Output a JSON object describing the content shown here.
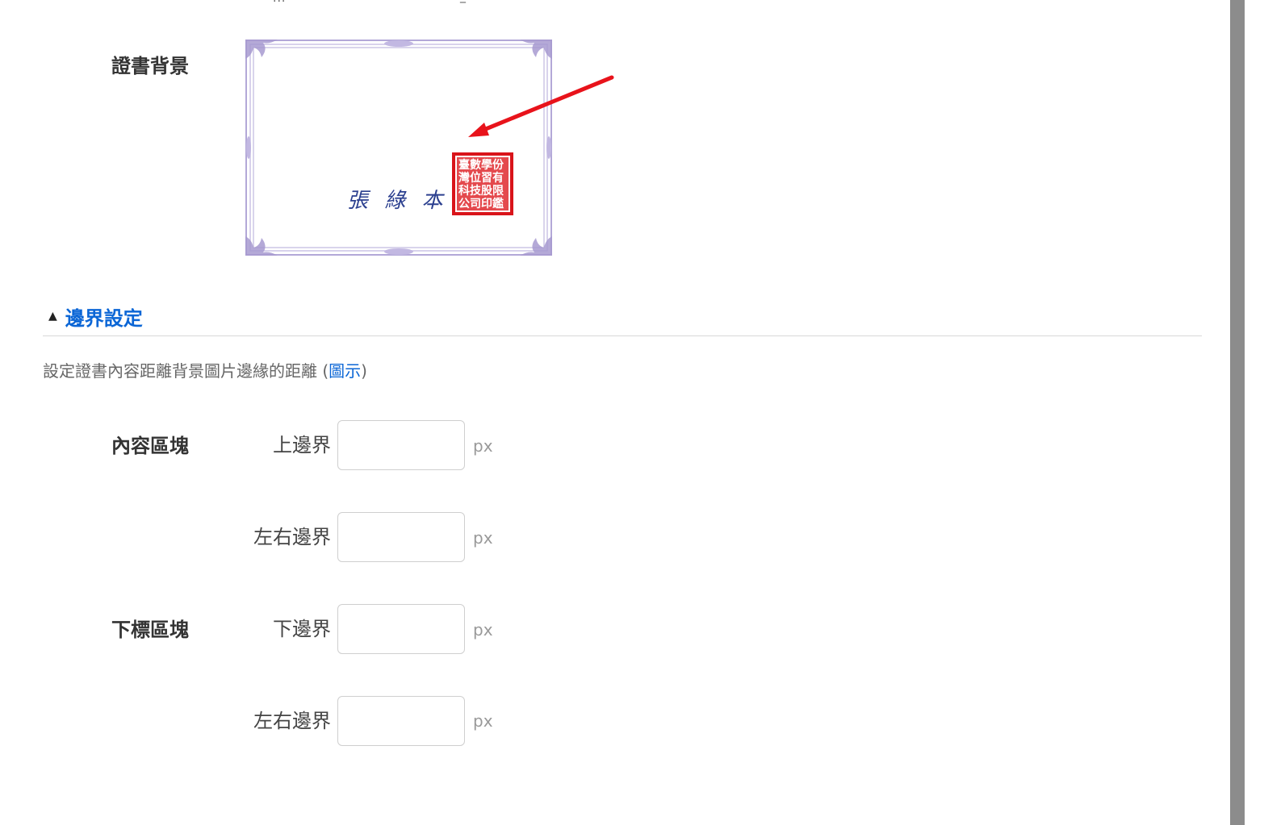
{
  "top_cut": {
    "text": "...",
    "underscore": "_"
  },
  "certificate_background": {
    "label": "證書背景",
    "preview": {
      "signature_text": "張 綠 本",
      "seal_chars": [
        "臺",
        "灣",
        "數",
        "位",
        "學",
        "習",
        "科",
        "技",
        "股",
        "份",
        "有",
        "限",
        "公",
        "司",
        "印",
        "鑑"
      ],
      "border_color": "#a79ad0",
      "seal_color": "#d9141a",
      "signature_color": "#2b3f8f"
    },
    "arrow_color": "#e8131b"
  },
  "boundary_section": {
    "caret": "▲",
    "title": "邊界設定",
    "description": "設定證書內容距離背景圖片邊緣的距離 (",
    "description_link": "圖示",
    "description_end": ")"
  },
  "content_block": {
    "label": "內容區塊",
    "top_margin": {
      "label": "上邊界",
      "value": "",
      "unit": "px"
    },
    "lr_margin": {
      "label": "左右邊界",
      "value": "",
      "unit": "px"
    }
  },
  "footer_block": {
    "label": "下標區塊",
    "bottom_margin": {
      "label": "下邊界",
      "value": "",
      "unit": "px"
    },
    "lr_margin": {
      "label": "左右邊界",
      "value": "",
      "unit": "px"
    }
  }
}
